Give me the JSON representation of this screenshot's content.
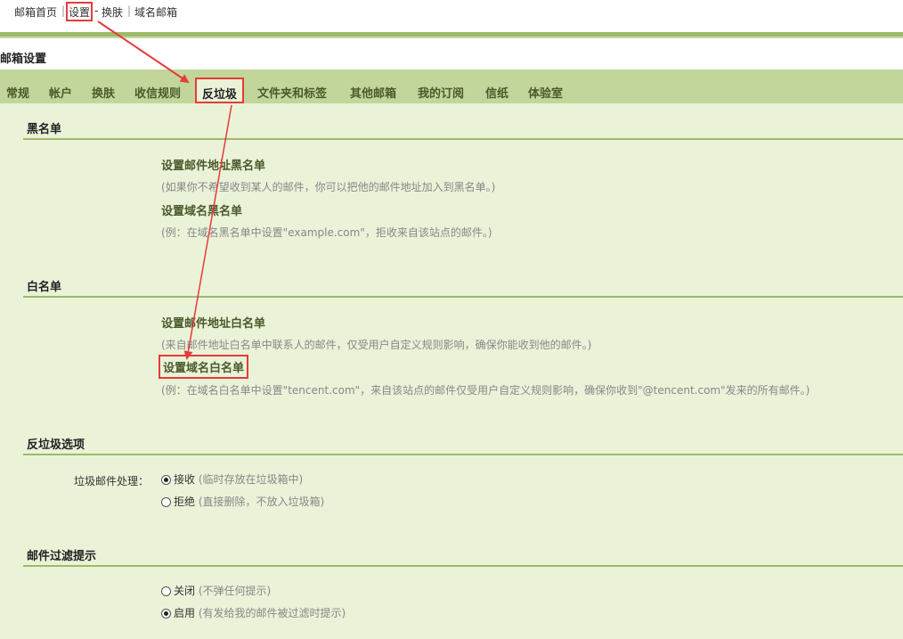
{
  "topnav": {
    "home": "邮箱首页",
    "settings": "设置",
    "dash": "-",
    "skin": "换肤",
    "domain_mail": "域名邮箱"
  },
  "page_title": "邮箱设置",
  "tabs": [
    "常规",
    "帐户",
    "换肤",
    "收信规则",
    "反垃圾",
    "文件夹和标签",
    "其他邮箱",
    "我的订阅",
    "信纸",
    "体验室"
  ],
  "active_tab": "反垃圾",
  "blacklist": {
    "title": "黑名单",
    "items": [
      {
        "label": "设置邮件地址黑名单",
        "desc": "(如果你不希望收到某人的邮件，你可以把他的邮件地址加入到黑名单。)"
      },
      {
        "label": "设置域名黑名单",
        "desc": "(例：在域名黑名单中设置\"example.com\"，拒收来自该站点的邮件。)"
      }
    ]
  },
  "whitelist": {
    "title": "白名单",
    "items": [
      {
        "label": "设置邮件地址白名单",
        "desc": "(来自邮件地址白名单中联系人的邮件，仅受用户自定义规则影响，确保你能收到他的邮件。)"
      },
      {
        "label": "设置域名白名单",
        "desc": "(例：在域名白名单中设置\"tencent.com\"，来自该站点的邮件仅受用户自定义规则影响，确保你收到\"@tencent.com\"发来的所有邮件。)"
      }
    ]
  },
  "antispam": {
    "title": "反垃圾选项",
    "field_label": "垃圾邮件处理：",
    "options": [
      {
        "label": "接收",
        "hint": "(临时存放在垃圾箱中)",
        "checked": true
      },
      {
        "label": "拒绝",
        "hint": "(直接删除，不放入垃圾箱)",
        "checked": false
      }
    ]
  },
  "filter_tip": {
    "title": "邮件过滤提示",
    "options": [
      {
        "label": "关闭",
        "hint": "(不弹任何提示)",
        "checked": false
      },
      {
        "label": "启用",
        "hint": "(有发给我的邮件被过滤时提示)",
        "checked": true
      }
    ]
  },
  "colors": {
    "accent_green": "#9dba6a",
    "tab_bar": "#c2d69b",
    "content_bg": "#eaf2d8",
    "highlight_red": "#e53b3b"
  }
}
